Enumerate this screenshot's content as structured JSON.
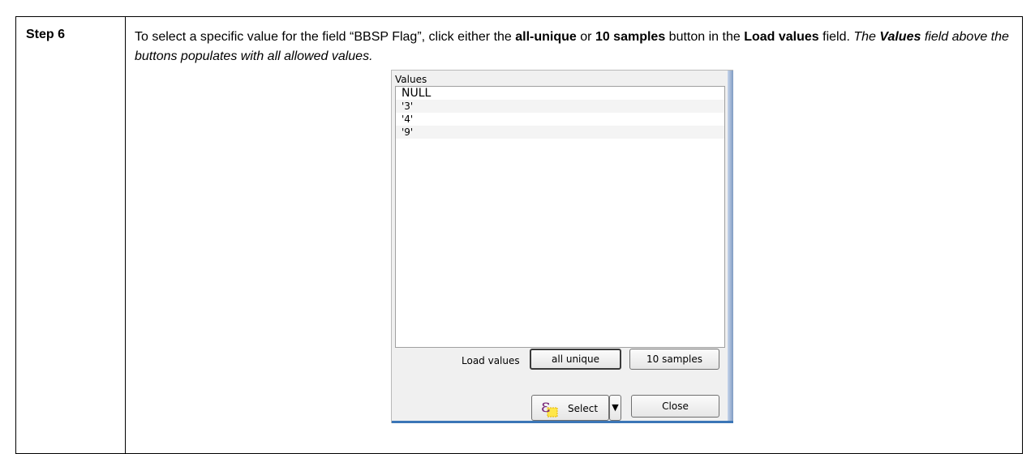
{
  "step": {
    "label": "Step 6"
  },
  "instructions": {
    "part1": "To select a specific value for the field “BBSP Flag”, click either the ",
    "bold1": "all-unique",
    "part2": " or ",
    "bold2": "10 samples",
    "part3": " button in the ",
    "bold3": "Load values",
    "part4": " field. ",
    "italic1": "The ",
    "italic_bold": "Values",
    "italic2": " field above the buttons populates with all allowed values."
  },
  "dialog": {
    "values_label": "Values",
    "values": [
      "NULL",
      "'3'",
      "'4'",
      "'9'"
    ],
    "load_values_label": "Load values",
    "all_unique_button": "all unique",
    "samples_button": "10 samples",
    "select_button": "Select",
    "close_button": "Close",
    "select_icon": "epsilon-expression-icon",
    "dropdown_icon": "triangle-down-icon"
  }
}
